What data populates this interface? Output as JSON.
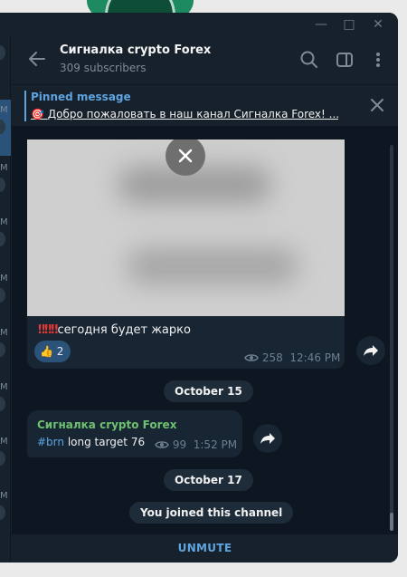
{
  "window": {
    "minimize_glyph": "—",
    "maximize_glyph": "□",
    "close_glyph": "✕"
  },
  "left_rail": {
    "letters": [
      "M",
      "M",
      "M",
      "M",
      "M",
      "M",
      "M",
      "M"
    ]
  },
  "header": {
    "title": "Сигналка crypto Forex",
    "subtitle": "309 subscribers"
  },
  "pinned": {
    "label": "Pinned message",
    "emoji": "🎯",
    "text": "Добро пожаловать в наш канал Сигналка Forex! ..."
  },
  "post": {
    "bangs": "‼‼‼",
    "text": "сегодня будет жарко",
    "reaction_emoji": "👍",
    "reaction_count": "2",
    "views": "258",
    "time": "12:46 PM"
  },
  "dates": {
    "first": "October 15",
    "second": "October 17"
  },
  "message": {
    "sender": "Сигналка crypto Forex",
    "hashtag": "#brn",
    "text": " long  target 76",
    "views": "99",
    "time": "1:52 PM"
  },
  "service": {
    "joined": "You joined this channel"
  },
  "footer": {
    "unmute_label": "UNMUTE"
  },
  "colors": {
    "accent": "#5ea4e0",
    "sender": "#6ec170",
    "background": "#0e1621",
    "panel": "#17212b",
    "bubble": "#182533"
  }
}
